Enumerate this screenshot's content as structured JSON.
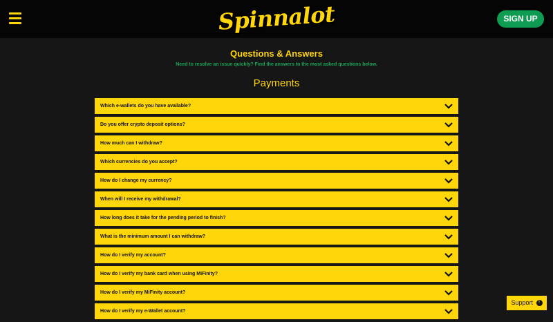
{
  "header": {
    "logo_text": "Spinnalot",
    "signup_label": "SIGN UP",
    "menu_icon": "hamburger-icon"
  },
  "intro": {
    "title": "Questions & Answers",
    "subtitle": "Need to resolve an issue quickly? Find the answers to the most asked questions below."
  },
  "section": {
    "title": "Payments"
  },
  "faq": {
    "items": [
      {
        "question": "Which e-wallets do you have available?"
      },
      {
        "question": "Do you offer crypto deposit options?"
      },
      {
        "question": "How much can I withdraw?"
      },
      {
        "question": "Which currencies do you accept?"
      },
      {
        "question": "How do I change my currency?"
      },
      {
        "question": "When will I receive my withdrawal?"
      },
      {
        "question": "How long does it take for the pending period to finish?"
      },
      {
        "question": "What is the minimum amount I can withdraw?"
      },
      {
        "question": "How do I verify my account?"
      },
      {
        "question": "How do I verify my bank card when using MiFinity?"
      },
      {
        "question": "How do I verify my MiFinity account?"
      },
      {
        "question": "How do I verify my e-Wallet account?"
      }
    ]
  },
  "support": {
    "label": "Support",
    "icon_glyph": "!"
  },
  "colors": {
    "accent_yellow": "#ffd60a",
    "signup_green": "#0e9c52",
    "subtitle_green": "#16a85a",
    "background": "#161616",
    "topbar": "#050505"
  }
}
